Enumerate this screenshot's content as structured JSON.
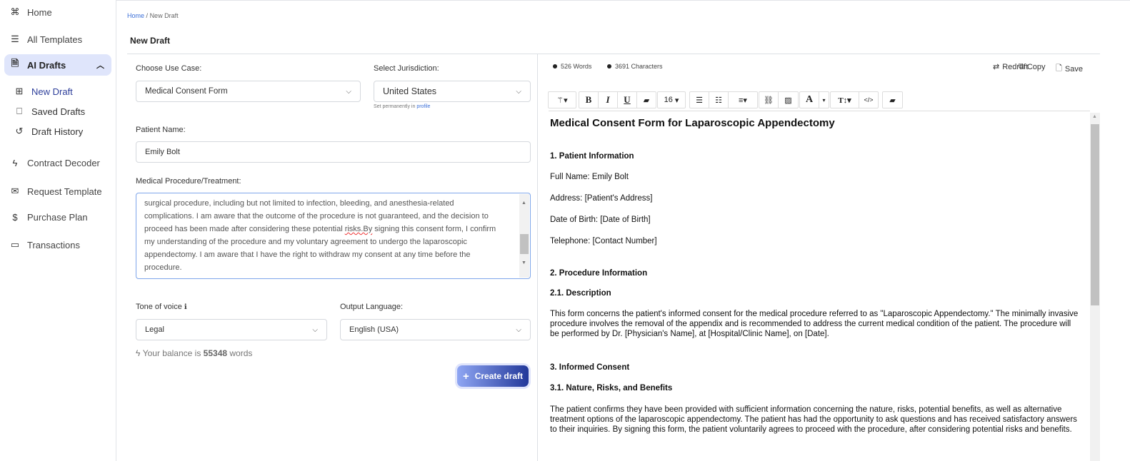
{
  "sidebar": {
    "items": [
      {
        "label": "Home",
        "icon": "command-icon"
      },
      {
        "label": "All Templates",
        "icon": "list-icon"
      },
      {
        "label": "AI Drafts",
        "icon": "document-icon"
      },
      {
        "label": "New Draft",
        "icon": "plus-square-icon"
      },
      {
        "label": "Saved Drafts",
        "icon": "bookmark-icon"
      },
      {
        "label": "Draft History",
        "icon": "history-icon"
      },
      {
        "label": "Contract Decoder",
        "icon": "bolt-icon"
      },
      {
        "label": "Request Template",
        "icon": "mail-icon"
      },
      {
        "label": "Purchase Plan",
        "icon": "dollar-icon"
      },
      {
        "label": "Transactions",
        "icon": "credit-card-icon"
      }
    ]
  },
  "breadcrumb": {
    "home": "Home",
    "sep": "/",
    "current": "New Draft"
  },
  "page_title": "New Draft",
  "form": {
    "use_case_label": "Choose Use Case:",
    "use_case_value": "Medical Consent Form",
    "jurisdiction_label": "Select Jurisdiction:",
    "jurisdiction_value": "United States",
    "jurisdiction_hint": "Set permanently in",
    "jurisdiction_hint_link": "profile",
    "patient_label": "Patient Name:",
    "patient_value": "Emily Bolt",
    "procedure_label": "Medical Procedure/Treatment:",
    "procedure_lines": [
      "surgical procedure, including but not limited to infection, bleeding, and anesthesia-related",
      "complications. I am aware that the outcome of the procedure is not guaranteed, and the decision to",
      "proceed has been made after considering these potential ",
      "risks.By",
      " signing this consent form, I confirm",
      "my understanding of the procedure and my voluntary agreement to undergo the laparoscopic",
      "appendectomy. I am aware that I have the right to withdraw my consent at any time before the",
      "procedure."
    ],
    "tone_label": "Tone of voice",
    "tone_value": "Legal",
    "language_label": "Output Language:",
    "language_value": "English (USA)",
    "balance_prefix": "Your balance is",
    "balance_value": "55348",
    "balance_suffix": "words",
    "create_label": "Create draft"
  },
  "editor": {
    "words": "526 Words",
    "characters": "3691 Characters",
    "redraft": "Redraft",
    "copy": "Copy",
    "save": "Save",
    "font_size": "16",
    "doc": {
      "title": "Medical Consent Form for Laparoscopic Appendectomy",
      "s1": "1. Patient Information",
      "name": "Full Name: Emily Bolt",
      "address": "Address: [Patient's Address]",
      "dob": "Date of Birth: [Date of Birth]",
      "phone": "Telephone: [Contact Number]",
      "s2": "2. Procedure Information",
      "s21": "2.1. Description",
      "desc": "This form concerns the patient's informed consent for the medical procedure referred to as \"Laparoscopic Appendectomy.\" The minimally invasive procedure involves the removal of the appendix and is recommended to address the current medical condition of the patient. The procedure will be performed by Dr. [Physician's Name], at [Hospital/Clinic Name], on [Date].",
      "s3": "3. Informed Consent",
      "s31": "3.1. Nature, Risks, and Benefits",
      "consent": "The patient confirms they have been provided with sufficient information concerning the nature, risks, potential benefits, as well as alternative treatment options of the laparoscopic appendectomy. The patient has had the opportunity to ask questions and has received satisfactory answers to their inquiries. By signing this form, the patient voluntarily agrees to proceed with the procedure, after considering potential risks and benefits."
    }
  }
}
